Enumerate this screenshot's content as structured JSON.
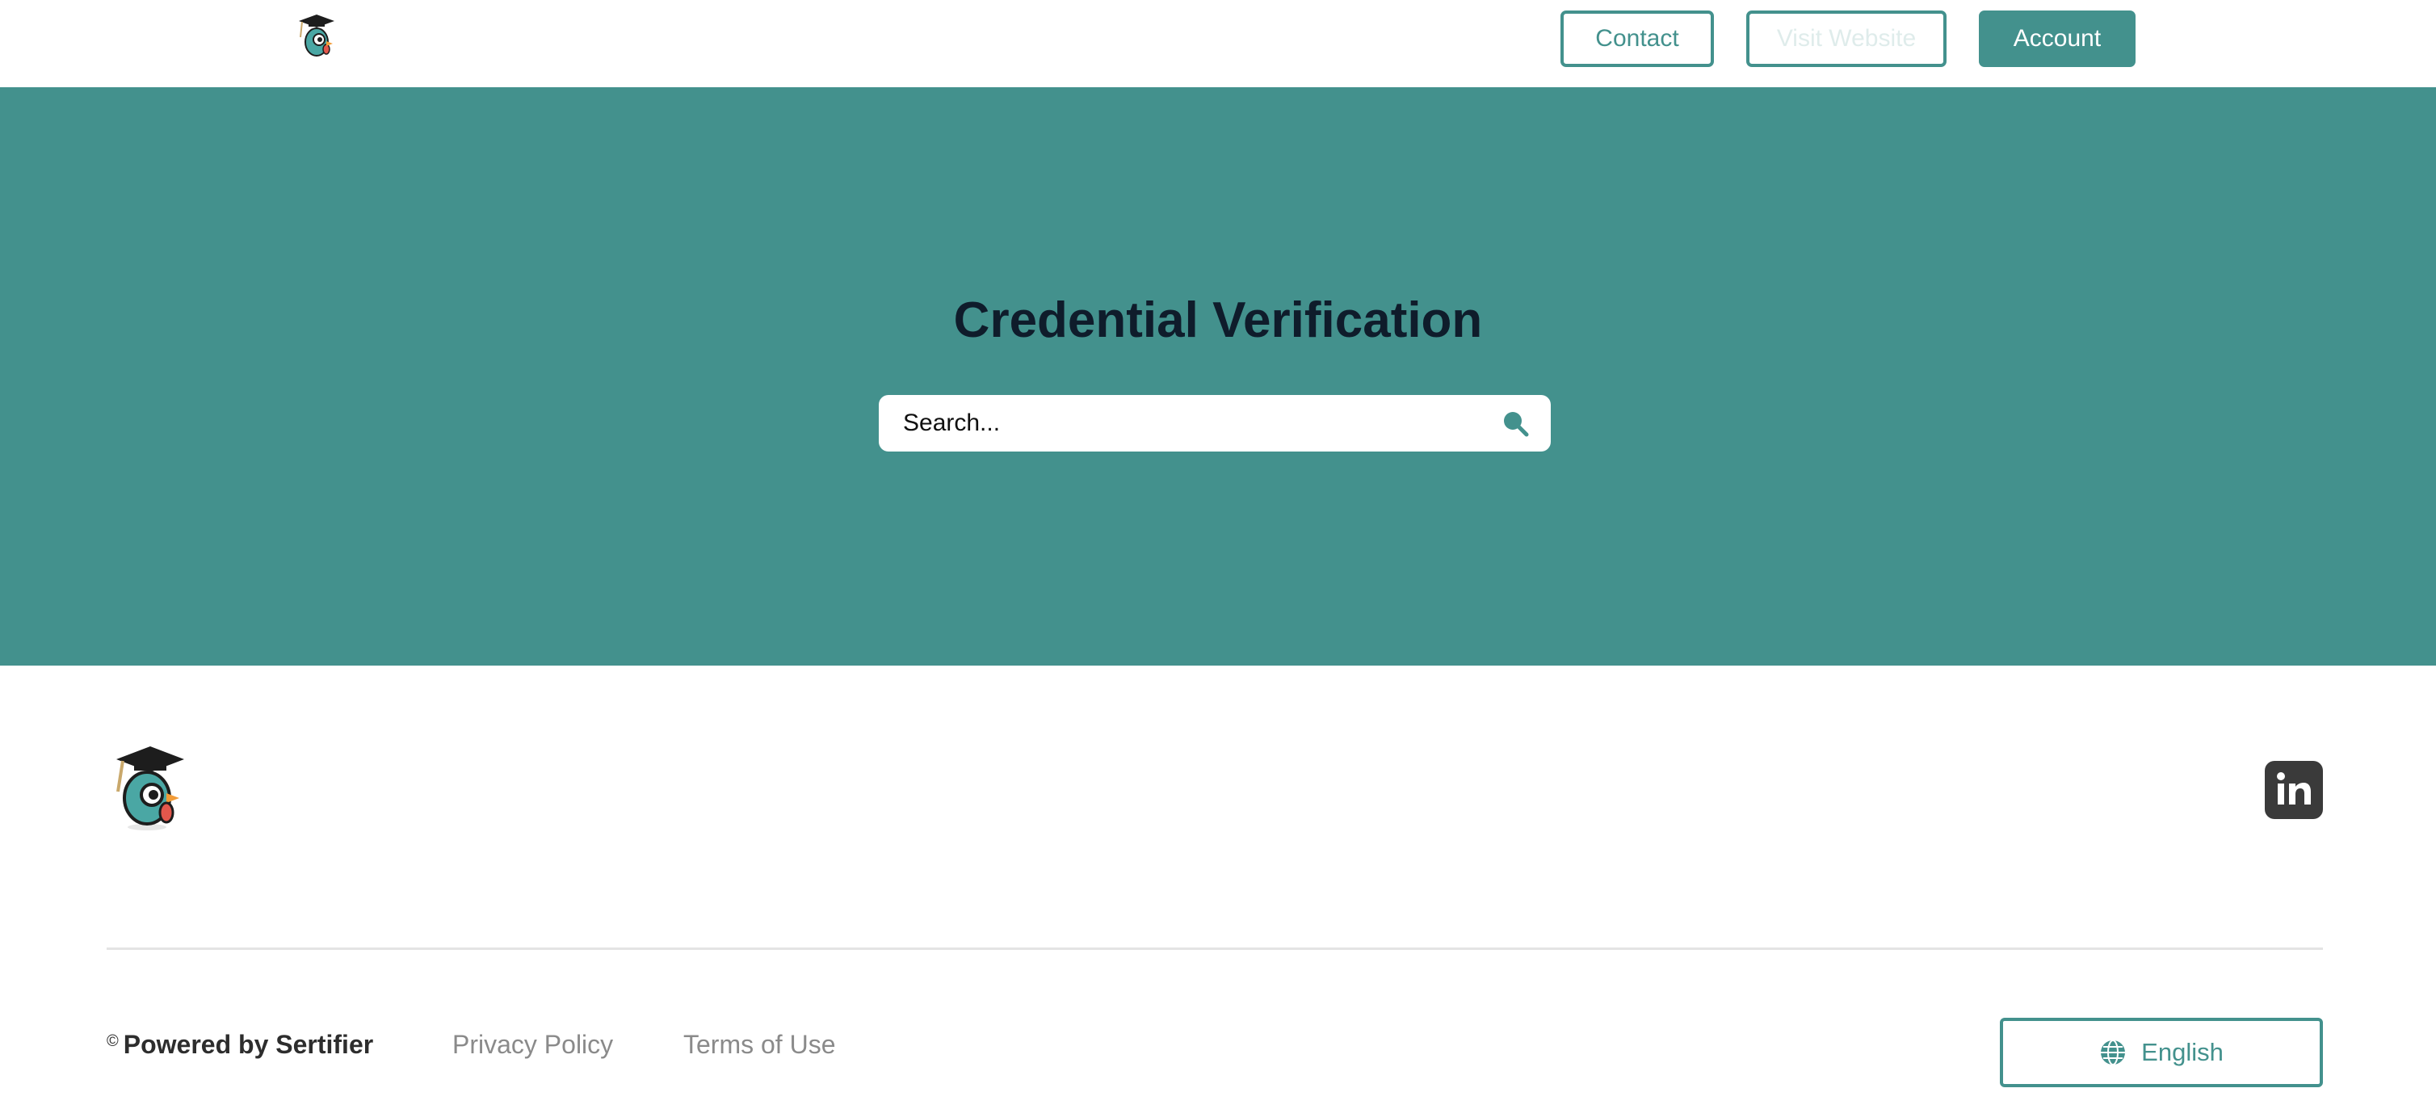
{
  "header": {
    "logo_icon": "graduation-bird-logo",
    "contact_label": "Contact",
    "visit_label": "Visit Website",
    "account_label": "Account"
  },
  "hero": {
    "title": "Credential Verification",
    "search_placeholder": "Search...",
    "search_icon": "search-icon"
  },
  "footer": {
    "logo_icon": "graduation-bird-logo",
    "social_icon": "linkedin-icon",
    "copyright_symbol": "©",
    "powered_by": "Powered by Sertifier",
    "privacy_label": "Privacy Policy",
    "terms_label": "Terms of Use",
    "language_icon": "globe-icon",
    "language_label": "English"
  },
  "colors": {
    "accent": "#43918d",
    "title_text": "#0f1c2b",
    "muted_link": "#8a8a8a",
    "social_bg": "#3a3a3a"
  }
}
